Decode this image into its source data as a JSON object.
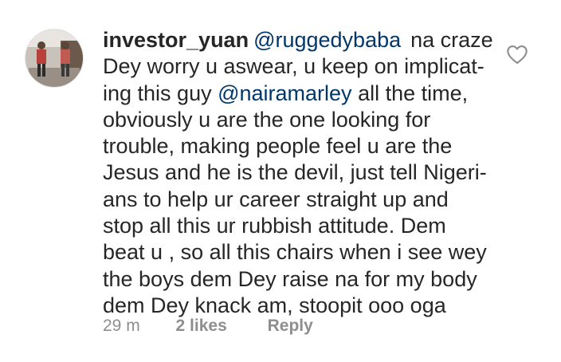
{
  "comment": {
    "username": "investor_yuan",
    "mention_1": "@ruggedybaba",
    "text_after_mention_1": "na craze",
    "line_2": "Dey worry u aswear, u keep on implicat-",
    "line_3_pre": "ing this guy ",
    "mention_2": "@nairamarley",
    "line_3_post": " all the time,",
    "line_4": "obviously u are the one looking for",
    "line_5": "trouble, making people feel u are the",
    "line_6": "Jesus and he is the devil, just tell Nigeri-",
    "line_7": "ans to help ur career straight up and",
    "line_8": "stop all this ur rubbish attitude. Dem",
    "line_9": "beat u , so all this chairs when i see wey",
    "line_10": "the boys dem Dey raise na for my body",
    "line_11": "dem Dey knack am, stoopit ooo oga"
  },
  "meta": {
    "time": "29 m",
    "likes": "2 likes",
    "reply": "Reply"
  },
  "icons": {
    "like": "heart-outline-icon",
    "avatar": "profile-photo"
  },
  "colors": {
    "text": "#262626",
    "mention": "#00376b",
    "muted": "#8e8e8e"
  }
}
